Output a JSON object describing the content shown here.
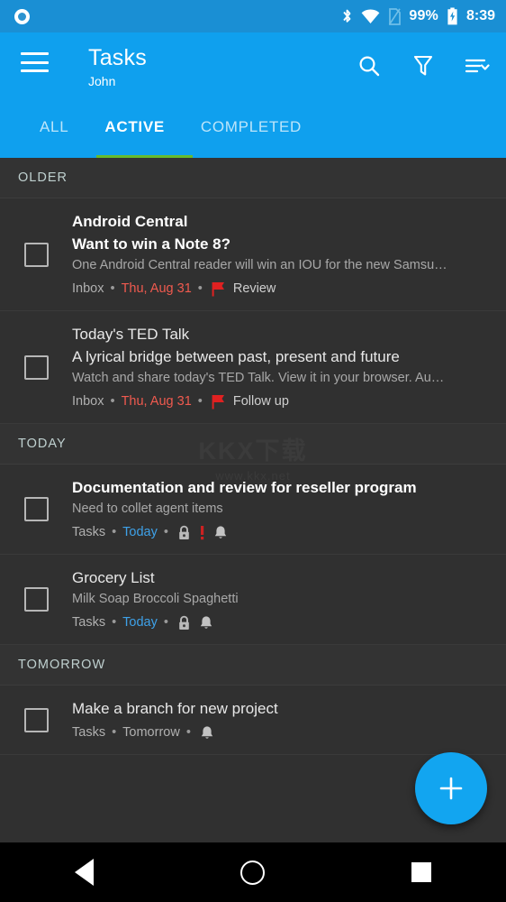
{
  "statusbar": {
    "battery_percent": "99%",
    "time": "8:39",
    "icons": [
      "bluetooth-icon",
      "wifi-icon",
      "no-sim-icon",
      "battery-charging-icon"
    ]
  },
  "appbar": {
    "menu_icon": "hamburger-menu-icon",
    "title": "Tasks",
    "subtitle": "John",
    "actions": [
      {
        "name": "search-button",
        "icon": "search-icon"
      },
      {
        "name": "filter-button",
        "icon": "filter-funnel-icon"
      },
      {
        "name": "sort-button",
        "icon": "sort-icon"
      }
    ]
  },
  "tabs": {
    "items": [
      {
        "label": "ALL",
        "selected": false
      },
      {
        "label": "ACTIVE",
        "selected": true
      },
      {
        "label": "COMPLETED",
        "selected": false
      }
    ],
    "indicator_color": "#66bb2e"
  },
  "colors": {
    "accent": "#0fa0ee",
    "fab": "#12a5f0",
    "overdue_red": "#f05a4f",
    "today_blue": "#3ea1e8",
    "section_header": "#bfd0cf",
    "background": "#303030"
  },
  "sections": [
    {
      "header": "OLDER",
      "items": [
        {
          "line1": "Android Central",
          "line2": "Want to win a Note 8?",
          "bold": true,
          "snippet": "One Android Central reader will win an IOU for the new Samsu…",
          "list": "Inbox",
          "date": "Thu, Aug 31",
          "date_style": "red",
          "flag_label": "Review",
          "icons": [
            "flag-icon"
          ]
        },
        {
          "line1": "Today's TED Talk",
          "line2": "A lyrical bridge between past, present and future",
          "bold": false,
          "snippet": "Watch and share today's TED Talk. View it in your browser. Au…",
          "list": "Inbox",
          "date": "Thu, Aug 31",
          "date_style": "red",
          "flag_label": "Follow up",
          "icons": [
            "flag-icon"
          ]
        }
      ]
    },
    {
      "header": "TODAY",
      "items": [
        {
          "line1": "Documentation and review for reseller program",
          "line2": "",
          "bold": true,
          "snippet": "Need to collet agent items",
          "list": "Tasks",
          "date": "Today",
          "date_style": "blue",
          "flag_label": "",
          "icons": [
            "lock-icon",
            "priority-exclamation-icon",
            "bell-icon"
          ]
        },
        {
          "line1": "Grocery List",
          "line2": "",
          "bold": false,
          "snippet": "Milk Soap Broccoli Spaghetti",
          "list": "Tasks",
          "date": "Today",
          "date_style": "blue",
          "flag_label": "",
          "icons": [
            "lock-icon",
            "bell-icon"
          ]
        }
      ]
    },
    {
      "header": "TOMORROW",
      "items": [
        {
          "line1": "Make a branch for new project",
          "line2": "",
          "bold": false,
          "snippet": "",
          "list": "Tasks",
          "date": "Tomorrow",
          "date_style": "grey",
          "flag_label": "",
          "icons": [
            "bell-icon"
          ]
        }
      ]
    }
  ],
  "fab": {
    "icon": "plus-icon",
    "label": "+"
  },
  "watermark": {
    "main": "KKX下载",
    "sub": "www.kkx.net"
  },
  "navbar": {
    "back": "back-triangle-icon",
    "home": "home-circle-icon",
    "recents": "recents-square-icon"
  }
}
